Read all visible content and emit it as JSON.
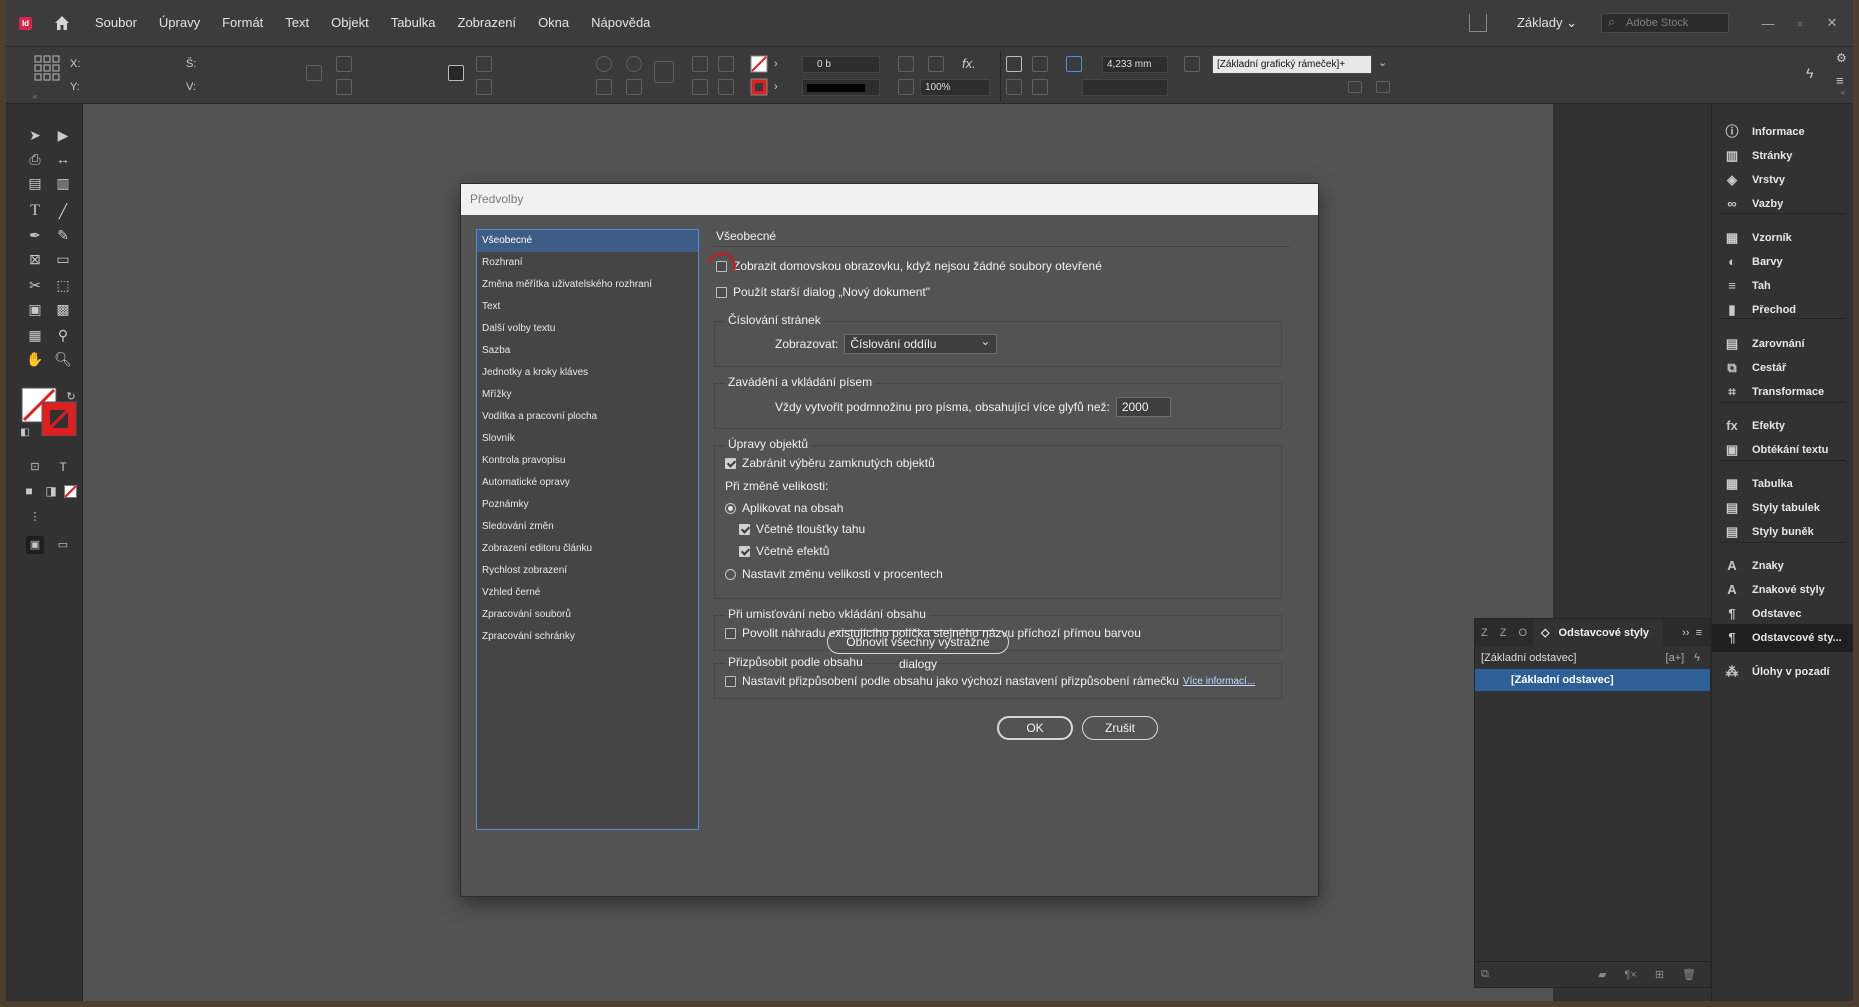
{
  "menubar": {
    "logo": "Id",
    "items": [
      "Soubor",
      "Úpravy",
      "Formát",
      "Text",
      "Objekt",
      "Tabulka",
      "Zobrazení",
      "Okna",
      "Nápověda"
    ],
    "workspace": "Základy",
    "stock_placeholder": "Adobe Stock"
  },
  "control": {
    "x_label": "X:",
    "y_label": "Y:",
    "w_label": "Š:",
    "h_label": "V:",
    "stroke_weight": "0 b",
    "scale": "100%",
    "spacing": "4,233 mm",
    "frame_style": "[Základní grafický rámeček]+"
  },
  "dialog": {
    "title": "Předvolby",
    "categories": [
      "Všeobecné",
      "Rozhraní",
      "Změna měřítka uživatelského rozhraní",
      "Text",
      "Další volby textu",
      "Sazba",
      "Jednotky a kroky kláves",
      "Mřížky",
      "Vodítka a pracovní plocha",
      "Slovník",
      "Kontrola pravopisu",
      "Automatické opravy",
      "Poznámky",
      "Sledování změn",
      "Zobrazení editoru článku",
      "Rychlost zobrazení",
      "Vzhled černé",
      "Zpracování souborů",
      "Zpracování schránky"
    ],
    "selected_category": "Všeobecné",
    "pane_title": "Všeobecné",
    "show_home": {
      "label": "Zobrazit domovskou obrazovku, když nejsou žádné soubory otevřené",
      "checked": false
    },
    "legacy_new_doc": {
      "label": "Použít starší dialog „Nový dokument\"",
      "checked": false
    },
    "page_numbering": {
      "legend": "Číslování stránek",
      "view_label": "Zobrazovat:",
      "view_value": "Číslování oddílu"
    },
    "font_embedding": {
      "legend": "Zavádění a vkládání písem",
      "label": "Vždy vytvořit podmnožinu pro písma, obsahující více glyfů než:",
      "value": "2000"
    },
    "object_editing": {
      "legend": "Úpravy objektů",
      "prevent_locked": {
        "label": "Zabránit výběru zamknutých objektů",
        "checked": true
      },
      "resize_label": "Při změně velikosti:",
      "apply_content": {
        "label": "Aplikovat na obsah",
        "selected": true
      },
      "include_stroke": {
        "label": "Včetně tloušťky tahu",
        "checked": true
      },
      "include_effects": {
        "label": "Včetně efektů",
        "checked": true
      },
      "percent": {
        "label": "Nastavit změnu velikosti v procentech",
        "selected": false
      }
    },
    "placing": {
      "legend": "Při umisťování nebo vkládání obsahu",
      "allow_swatch": {
        "label": "Povolit náhradu existujícího políčka stejného názvu příchozí přímou barvou",
        "checked": false
      }
    },
    "content_aware": {
      "legend": "Přizpůsobit podle obsahu",
      "default_fit": {
        "label": "Nastavit přizpůsobení podle obsahu jako výchozí nastavení přizpůsobení rámečku",
        "checked": false
      },
      "more_link": "Více informací..."
    },
    "reset_warnings_label": "Obnovit všechny výstražné dialogy",
    "ok_label": "OK",
    "cancel_label": "Zrušit"
  },
  "right_panel": {
    "items": [
      "Informace",
      "Stránky",
      "Vrstvy",
      "Vazby",
      "Vzorník",
      "Barvy",
      "Tah",
      "Přechod",
      "Zarovnání",
      "Cestář",
      "Transformace",
      "Efekty",
      "Obtékání textu",
      "Tabulka",
      "Styly tabulek",
      "Styly buněk",
      "Znaky",
      "Znakové styly",
      "Odstavec",
      "Odstavcové sty...",
      "Úlohy v pozadí"
    ],
    "icons": [
      "info-icon",
      "pages-icon",
      "layers-icon",
      "links-icon",
      "swatches-icon",
      "color-icon",
      "stroke-icon",
      "gradient-icon",
      "align-icon",
      "pathfinder-icon",
      "transform-icon",
      "effects-icon",
      "text-wrap-icon",
      "table-icon",
      "table-styles-icon",
      "cell-styles-icon",
      "character-icon",
      "character-styles-icon",
      "paragraph-icon",
      "paragraph-styles-icon",
      "background-tasks-icon"
    ],
    "selected": "Odstavcové sty..."
  },
  "paragraph_styles_panel": {
    "tabs": [
      "Z",
      "Z",
      "O"
    ],
    "active_tab": "Odstavcové styly",
    "current": "[Základní odstavec]",
    "current_marker": "[a+]",
    "items": [
      "[Základní odstavec]"
    ]
  }
}
